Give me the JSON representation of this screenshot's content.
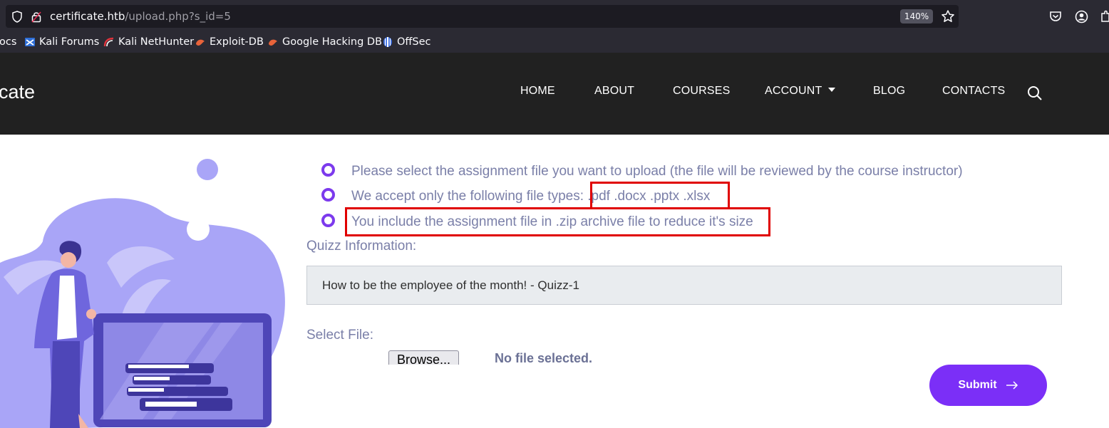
{
  "browser": {
    "url_host": "certificate.htb",
    "url_path": "/upload.php?s_id=5",
    "zoom": "140%",
    "bookmarks": [
      {
        "label": "ocs",
        "icon": "none"
      },
      {
        "label": "Kali Forums",
        "icon": "kali-forums-icon"
      },
      {
        "label": "Kali NetHunter",
        "icon": "kali-nethunter-icon"
      },
      {
        "label": "Exploit-DB",
        "icon": "exploit-db-icon"
      },
      {
        "label": "Google Hacking DB",
        "icon": "ghdb-icon"
      },
      {
        "label": "OffSec",
        "icon": "offsec-icon"
      }
    ]
  },
  "header": {
    "logo": "cate",
    "nav": [
      "HOME",
      "ABOUT",
      "COURSES",
      "ACCOUNT",
      "BLOG",
      "CONTACTS"
    ]
  },
  "instructions": [
    "Please select the assignment file you want to upload (the file will be reviewed by the course instructor)",
    "We accept only the following file types: .pdf .docx .pptx .xlsx",
    "You include the assignment file in .zip archive file to reduce it's size"
  ],
  "quiz": {
    "label": "Quizz Information:",
    "value": "How to be the employee of the month! - Quizz-1"
  },
  "file": {
    "label": "Select File:",
    "browse_label": "Browse...",
    "status": "No file selected."
  },
  "submit_label": "Submit",
  "colors": {
    "accent": "#7b2ff7",
    "text_muted": "#7a7fa8",
    "header_bg": "#212121",
    "highlight": "#e00000"
  }
}
